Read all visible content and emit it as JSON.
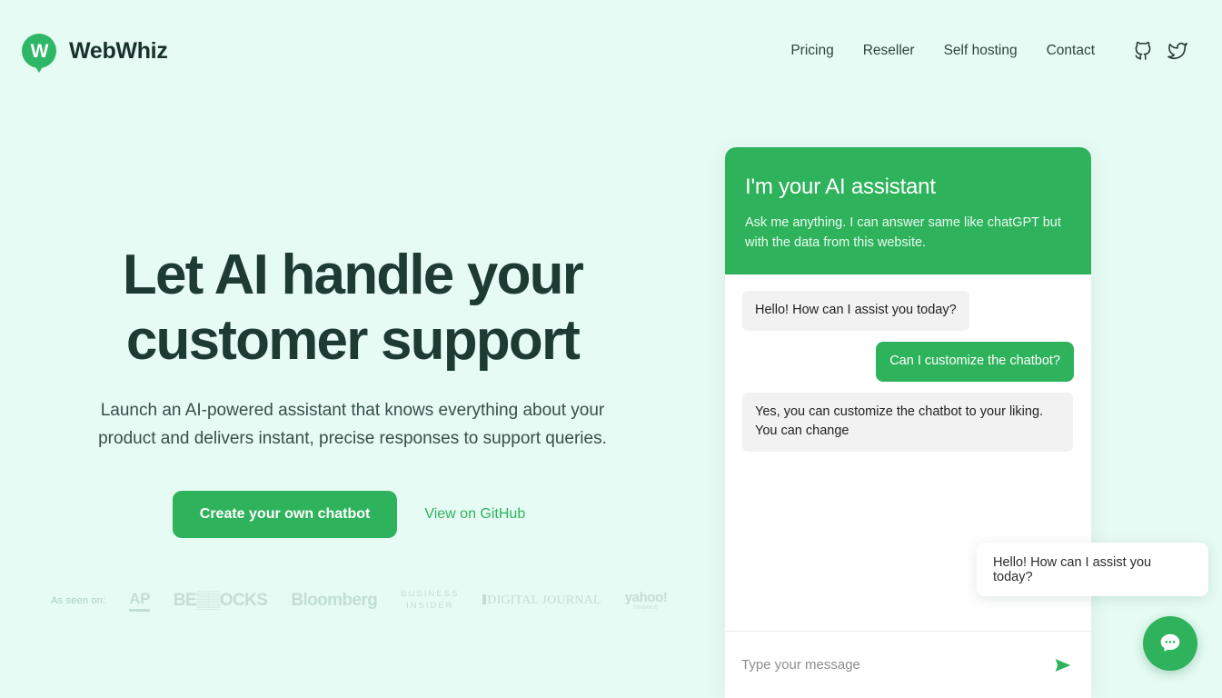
{
  "brand": {
    "name": "WebWhiz",
    "logo_letter": "W",
    "logo_color": "#2eb767"
  },
  "nav": {
    "links": [
      {
        "label": "Pricing"
      },
      {
        "label": "Reseller"
      },
      {
        "label": "Self hosting"
      },
      {
        "label": "Contact"
      }
    ],
    "icons": [
      {
        "name": "github-icon"
      },
      {
        "name": "twitter-icon"
      }
    ]
  },
  "hero": {
    "title": "Let AI handle your customer support",
    "subtitle": "Launch an AI-powered assistant that knows everything about your product and delivers instant, precise responses to support queries.",
    "primary_button": "Create your own chatbot",
    "secondary_link": "View on GitHub",
    "accent_color": "#2eb35c"
  },
  "press": {
    "label": "As seen on:",
    "logos": [
      {
        "name": "AP"
      },
      {
        "name": "BENZINGA STOCKS",
        "display": "BE▒▒OCKS"
      },
      {
        "name": "Bloomberg"
      },
      {
        "name": "BUSINESS INSIDER",
        "line1": "BUSINESS",
        "line2": "INSIDER"
      },
      {
        "name": "DIGITAL JOURNAL"
      },
      {
        "name": "yahoo! finance",
        "line1": "yahoo!",
        "line2": "finance"
      }
    ]
  },
  "chat_widget": {
    "header_title": "I'm your AI assistant",
    "header_subtitle": "Ask me anything. I can answer same like chatGPT but with the data from this website.",
    "messages": [
      {
        "sender": "bot",
        "text": "Hello! How can I assist you today?"
      },
      {
        "sender": "user",
        "text": "Can I customize the chatbot?"
      },
      {
        "sender": "bot",
        "text": "Yes, you can customize the chatbot to your liking. You can change"
      }
    ],
    "input_placeholder": "Type your message",
    "send_icon": "send-arrow-icon",
    "header_color": "#2eb35c"
  },
  "launcher": {
    "tooltip_text": "Hello! How can I assist you today?",
    "fab_icon": "chat-bubble-icon",
    "fab_color": "#2eb35c"
  }
}
